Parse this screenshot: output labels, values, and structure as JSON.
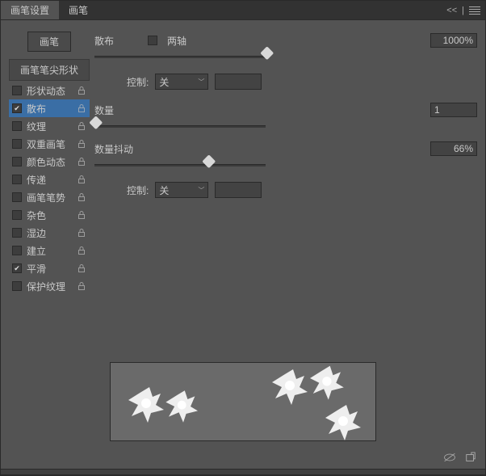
{
  "tabs": {
    "settings": "画笔设置",
    "brush": "画笔"
  },
  "side": {
    "brush_button": "画笔",
    "tip_shape": "画笔笔尖形状",
    "options": [
      {
        "label": "形状动态",
        "checked": false
      },
      {
        "label": "散布",
        "checked": true,
        "selected": true
      },
      {
        "label": "纹理",
        "checked": false
      },
      {
        "label": "双重画笔",
        "checked": false
      },
      {
        "label": "颜色动态",
        "checked": false
      },
      {
        "label": "传递",
        "checked": false
      },
      {
        "label": "画笔笔势",
        "checked": false
      },
      {
        "label": "杂色",
        "checked": false
      },
      {
        "label": "湿边",
        "checked": false
      },
      {
        "label": "建立",
        "checked": false
      },
      {
        "label": "平滑",
        "checked": true
      },
      {
        "label": "保护纹理",
        "checked": false
      }
    ]
  },
  "main": {
    "scatter_label": "散布",
    "both_axes": "两轴",
    "scatter_value": "1000%",
    "control_label": "控制:",
    "control_value": "关",
    "count_label": "数量",
    "count_value": "1",
    "jitter_label": "数量抖动",
    "jitter_value": "66%"
  }
}
